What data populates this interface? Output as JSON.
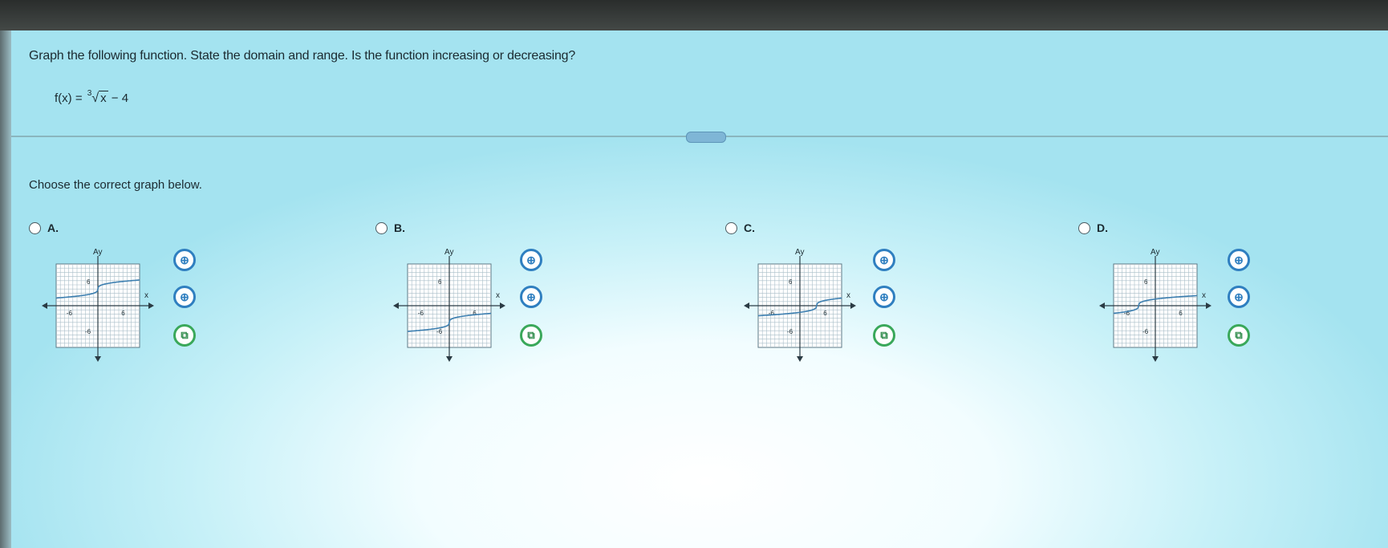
{
  "question": {
    "text": "Graph the following function. State the domain and range. Is the function increasing or decreasing?",
    "formula_lhs": "f(x) =",
    "root_index": "3",
    "radical_sign": "√",
    "radicand": "x",
    "formula_rhs": "− 4"
  },
  "prompt": "Choose the correct graph below.",
  "choices": [
    {
      "letter": "A."
    },
    {
      "letter": "B."
    },
    {
      "letter": "C."
    },
    {
      "letter": "D."
    }
  ],
  "axis_labels": {
    "x": "x",
    "y": "Ay",
    "tick_pos": "6",
    "tick_neg": "-6"
  },
  "icons": {
    "zoom_in": "zoom-in-icon",
    "zoom_out": "zoom-out-icon",
    "edit": "edit-icon"
  },
  "tool_glyphs": {
    "zoom": "⊕",
    "edit": "⧉"
  },
  "colors": {
    "accent": "#2f7fc0",
    "edit": "#3aa85a"
  },
  "chart_data": [
    {
      "type": "line",
      "choice": "A",
      "curve": "cbrt",
      "h_shift": 0,
      "v_shift": 4,
      "xlim": [
        -10,
        10
      ],
      "ylim": [
        -10,
        10
      ]
    },
    {
      "type": "line",
      "choice": "B",
      "curve": "cbrt",
      "h_shift": 0,
      "v_shift": -4,
      "xlim": [
        -10,
        10
      ],
      "ylim": [
        -10,
        10
      ]
    },
    {
      "type": "line",
      "choice": "C",
      "curve": "cbrt",
      "h_shift": 4,
      "v_shift": 0,
      "xlim": [
        -10,
        10
      ],
      "ylim": [
        -10,
        10
      ]
    },
    {
      "type": "line",
      "choice": "D",
      "curve": "cbrt",
      "h_shift": -4,
      "v_shift": 0,
      "xlim": [
        -10,
        10
      ],
      "ylim": [
        -10,
        10
      ]
    }
  ]
}
